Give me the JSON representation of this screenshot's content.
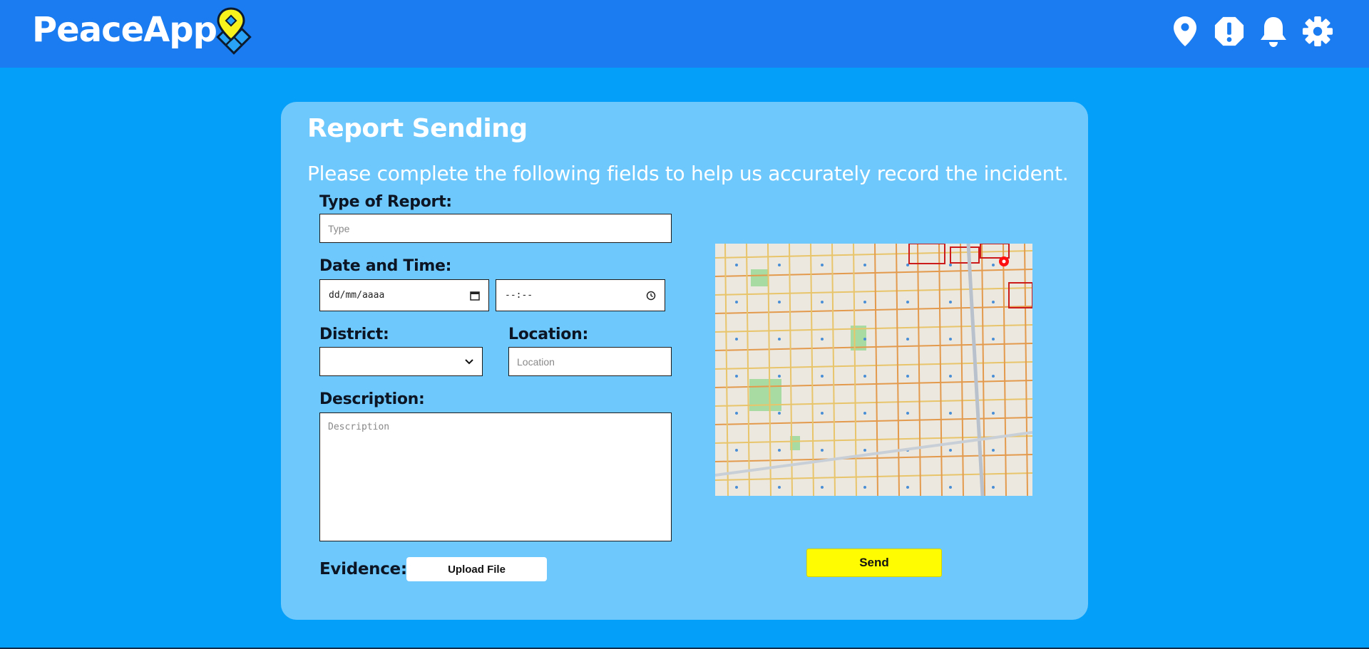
{
  "header": {
    "brand": "PeaceApp",
    "icons": [
      "location-pin-icon",
      "alert-icon",
      "bell-icon",
      "gear-icon"
    ]
  },
  "form": {
    "title": "Report Sending",
    "subtitle": "Please complete the following fields to help us accurately record the incident.",
    "type_label": "Type of Report:",
    "type_placeholder": "Type",
    "datetime_label": "Date and Time:",
    "date_placeholder": "dd/mm/aaaa",
    "time_placeholder": "--:--",
    "district_label": "District:",
    "district_value": "",
    "location_label": "Location:",
    "location_placeholder": "Location",
    "description_label": "Description:",
    "description_placeholder": "Description",
    "evidence_label": "Evidence:",
    "upload_label": "Upload File",
    "send_label": "Send"
  },
  "colors": {
    "page_bg": "#039ff9",
    "topbar_bg": "#1a7cf0",
    "card_bg": "#6fc8fb",
    "send_bg": "#fffb00"
  }
}
